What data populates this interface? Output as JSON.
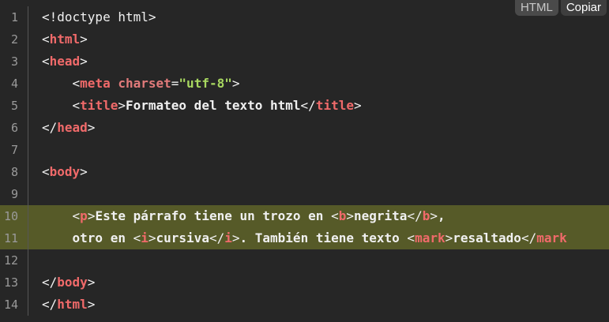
{
  "toolbar": {
    "language_label": "HTML",
    "copy_label": "Copiar"
  },
  "code": {
    "lines": [
      {
        "num": "1",
        "highlight": false,
        "tokens": [
          {
            "c": "p",
            "t": "<!doctype html>"
          }
        ]
      },
      {
        "num": "2",
        "highlight": false,
        "tokens": [
          {
            "c": "p",
            "t": "<"
          },
          {
            "c": "t",
            "t": "html"
          },
          {
            "c": "p",
            "t": ">"
          }
        ]
      },
      {
        "num": "3",
        "highlight": false,
        "tokens": [
          {
            "c": "p",
            "t": "<"
          },
          {
            "c": "t",
            "t": "head"
          },
          {
            "c": "p",
            "t": ">"
          }
        ]
      },
      {
        "num": "4",
        "highlight": false,
        "tokens": [
          {
            "c": "p",
            "t": "    <"
          },
          {
            "c": "t",
            "t": "meta"
          },
          {
            "c": "p",
            "t": " "
          },
          {
            "c": "a",
            "t": "charset"
          },
          {
            "c": "p",
            "t": "="
          },
          {
            "c": "s",
            "t": "\"utf-8\""
          },
          {
            "c": "p",
            "t": ">"
          }
        ]
      },
      {
        "num": "5",
        "highlight": false,
        "tokens": [
          {
            "c": "p",
            "t": "    <"
          },
          {
            "c": "t",
            "t": "title"
          },
          {
            "c": "p",
            "t": ">"
          },
          {
            "c": "x",
            "t": "Formateo del texto html"
          },
          {
            "c": "p",
            "t": "</"
          },
          {
            "c": "t",
            "t": "title"
          },
          {
            "c": "p",
            "t": ">"
          }
        ]
      },
      {
        "num": "6",
        "highlight": false,
        "tokens": [
          {
            "c": "p",
            "t": "</"
          },
          {
            "c": "t",
            "t": "head"
          },
          {
            "c": "p",
            "t": ">"
          }
        ]
      },
      {
        "num": "7",
        "highlight": false,
        "tokens": []
      },
      {
        "num": "8",
        "highlight": false,
        "tokens": [
          {
            "c": "p",
            "t": "<"
          },
          {
            "c": "t",
            "t": "body"
          },
          {
            "c": "p",
            "t": ">"
          }
        ]
      },
      {
        "num": "9",
        "highlight": false,
        "tokens": []
      },
      {
        "num": "10",
        "highlight": true,
        "tokens": [
          {
            "c": "p",
            "t": "    <"
          },
          {
            "c": "t",
            "t": "p"
          },
          {
            "c": "p",
            "t": ">"
          },
          {
            "c": "x",
            "t": "Este párrafo tiene un trozo en "
          },
          {
            "c": "p",
            "t": "<"
          },
          {
            "c": "t",
            "t": "b"
          },
          {
            "c": "p",
            "t": ">"
          },
          {
            "c": "x",
            "t": "negrita"
          },
          {
            "c": "p",
            "t": "</"
          },
          {
            "c": "t",
            "t": "b"
          },
          {
            "c": "p",
            "t": ">"
          },
          {
            "c": "x",
            "t": ","
          }
        ]
      },
      {
        "num": "11",
        "highlight": true,
        "tokens": [
          {
            "c": "x",
            "t": "    otro en "
          },
          {
            "c": "p",
            "t": "<"
          },
          {
            "c": "t",
            "t": "i"
          },
          {
            "c": "p",
            "t": ">"
          },
          {
            "c": "x",
            "t": "cursiva"
          },
          {
            "c": "p",
            "t": "</"
          },
          {
            "c": "t",
            "t": "i"
          },
          {
            "c": "p",
            "t": ">"
          },
          {
            "c": "x",
            "t": ". También tiene texto "
          },
          {
            "c": "p",
            "t": "<"
          },
          {
            "c": "t",
            "t": "mark"
          },
          {
            "c": "p",
            "t": ">"
          },
          {
            "c": "x",
            "t": "resaltado"
          },
          {
            "c": "p",
            "t": "</"
          },
          {
            "c": "t",
            "t": "mark"
          }
        ]
      },
      {
        "num": "12",
        "highlight": false,
        "tokens": []
      },
      {
        "num": "13",
        "highlight": false,
        "tokens": [
          {
            "c": "p",
            "t": "</"
          },
          {
            "c": "t",
            "t": "body"
          },
          {
            "c": "p",
            "t": ">"
          }
        ]
      },
      {
        "num": "14",
        "highlight": false,
        "tokens": [
          {
            "c": "p",
            "t": "</"
          },
          {
            "c": "t",
            "t": "html"
          },
          {
            "c": "p",
            "t": ">"
          }
        ]
      }
    ]
  },
  "colors": {
    "background": "#262626",
    "highlight": "#565a28",
    "tag": "#f06a6a",
    "attribute": "#e07a7a",
    "string": "#a8d860",
    "text": "#f0f0f0",
    "gutter": "#9a9a9a"
  }
}
